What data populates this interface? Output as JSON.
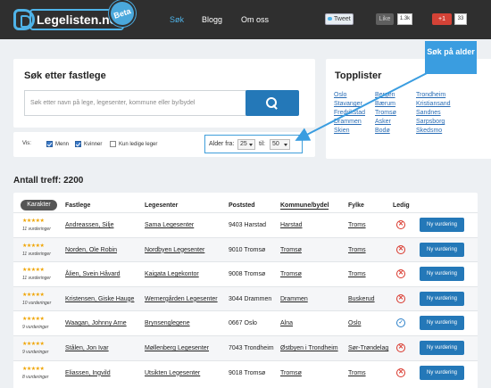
{
  "header": {
    "logo_text": "Legelisten.no",
    "beta": "Beta",
    "nav": [
      "Søk",
      "Blogg",
      "Om oss"
    ],
    "tweet": "Tweet",
    "like": "Like",
    "like_count": "1.3k",
    "gplus": "+1",
    "gplus_count": "33"
  },
  "search": {
    "title": "Søk etter fastlege",
    "placeholder": "Søk etter navn på lege, legesenter, kommune eller by/bydel"
  },
  "filter": {
    "vis": "Vis:",
    "menn": "Menn",
    "kvinner": "Kvinner",
    "ledige": "Kun ledige leger",
    "alder_fra": "Alder fra:",
    "fra_value": "25",
    "til": "til:",
    "til_value": "50"
  },
  "callout": "Søk på alder",
  "toplist": {
    "title": "Topplister",
    "col1": [
      "Oslo",
      "Stavanger",
      "Fredrikstad",
      "Drammen",
      "Skien"
    ],
    "col2": [
      "Bergen",
      "Bærum",
      "Tromsø",
      "Asker",
      "Bodø"
    ],
    "col3": [
      "Trondheim",
      "Kristiansand",
      "Sandnes",
      "Sarpsborg",
      "Skedsmo"
    ]
  },
  "results": {
    "count_label": "Antall treff: 2200",
    "headers": {
      "karakter": "Karakter",
      "fastlege": "Fastlege",
      "legesenter": "Legesenter",
      "poststed": "Poststed",
      "kommune": "Kommune/bydel",
      "fylke": "Fylke",
      "ledig": "Ledig"
    },
    "button_label": "Ny vurdering",
    "rows": [
      {
        "stars": "★★★★★",
        "vurd": "11 vurderinger",
        "lege": "Andreassen, Silje",
        "senter": "Sama Legesenter",
        "post": "9403 Harstad",
        "kommune": "Harstad",
        "fylke": "Troms",
        "ledig": "no"
      },
      {
        "stars": "★★★★★",
        "vurd": "11 vurderinger",
        "lege": "Norden, Ole Robin",
        "senter": "Nordbyen Legesenter",
        "post": "9010 Tromsø",
        "kommune": "Tromsø",
        "fylke": "Troms",
        "ledig": "no"
      },
      {
        "stars": "★★★★★",
        "vurd": "11 vurderinger",
        "lege": "Ålien, Svein Håvard",
        "senter": "Kaigata Legekontor",
        "post": "9008 Tromsø",
        "kommune": "Tromsø",
        "fylke": "Troms",
        "ledig": "no"
      },
      {
        "stars": "★★★★★",
        "vurd": "10 vurderinger",
        "lege": "Kristensen, Giske Hauge",
        "senter": "Wernergården Legesenter",
        "post": "3044 Drammen",
        "kommune": "Drammen",
        "fylke": "Buskerud",
        "ledig": "no"
      },
      {
        "stars": "★★★★★",
        "vurd": "9 vurderinger",
        "lege": "Waagan, Johnny Arne",
        "senter": "Brynsenglegene",
        "post": "0667 Oslo",
        "kommune": "Alna",
        "fylke": "Oslo",
        "ledig": "yes"
      },
      {
        "stars": "★★★★★",
        "vurd": "9 vurderinger",
        "lege": "Stålen, Jon Ivar",
        "senter": "Møllenberg Legesenter",
        "post": "7043 Trondheim",
        "kommune": "Østbyen i Trondheim",
        "fylke": "Sør-Trøndelag",
        "ledig": "no"
      },
      {
        "stars": "★★★★★",
        "vurd": "8 vurderinger",
        "lege": "Eliassen, Ingvild",
        "senter": "Utsikten Legesenter",
        "post": "9018 Tromsø",
        "kommune": "Tromsø",
        "fylke": "Troms",
        "ledig": "no"
      }
    ]
  }
}
